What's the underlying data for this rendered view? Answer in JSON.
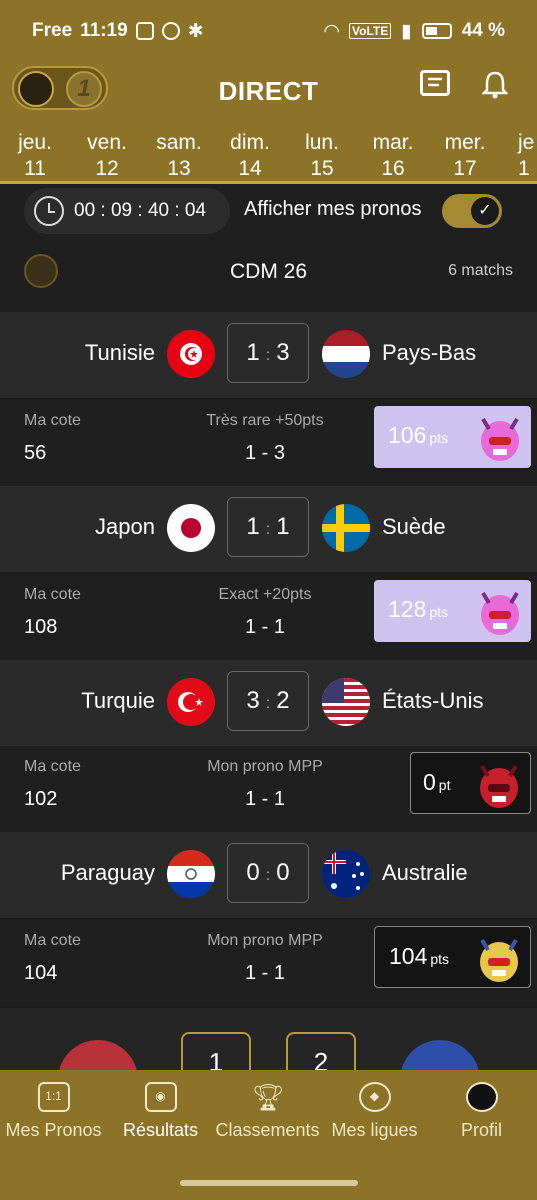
{
  "status_bar": {
    "carrier": "Free",
    "time": "11:19",
    "battery": "44 %"
  },
  "app_bar": {
    "title": "DIRECT",
    "logo_secondary_text": "1",
    "icons": [
      "message-icon",
      "bell-icon"
    ]
  },
  "days": [
    {
      "name": "jeu.",
      "num": "11"
    },
    {
      "name": "ven.",
      "num": "12"
    },
    {
      "name": "sam.",
      "num": "13"
    },
    {
      "name": "dim.",
      "num": "14"
    },
    {
      "name": "lun.",
      "num": "15"
    },
    {
      "name": "mar.",
      "num": "16"
    },
    {
      "name": "mer.",
      "num": "17"
    },
    {
      "name": "je",
      "num": "1"
    }
  ],
  "timer": {
    "value": "00 : 09 : 40 : 04"
  },
  "toggle": {
    "label": "Afficher mes pronos",
    "on": true
  },
  "competition": {
    "name": "CDM 26",
    "count": "6 matchs"
  },
  "matches": [
    {
      "home": "Tunisie",
      "away": "Pays-Bas",
      "home_score": "1",
      "away_score": "3",
      "sep": ":",
      "cote_label": "Ma cote",
      "cote_value": "56",
      "result_label": "Très rare +50pts",
      "prono": "1 - 3",
      "points": "106",
      "points_unit": "pts",
      "style": "light"
    },
    {
      "home": "Japon",
      "away": "Suède",
      "home_score": "1",
      "away_score": "1",
      "sep": ":",
      "cote_label": "Ma cote",
      "cote_value": "108",
      "result_label": "Exact +20pts",
      "prono": "1 - 1",
      "points": "128",
      "points_unit": "pts",
      "style": "light"
    },
    {
      "home": "Turquie",
      "away": "États-Unis",
      "home_score": "3",
      "away_score": "2",
      "sep": ":",
      "cote_label": "Ma cote",
      "cote_value": "102",
      "result_label": "Mon prono MPP",
      "prono": "1 - 1",
      "points": "0",
      "points_unit": "pt",
      "style": "dark"
    },
    {
      "home": "Paraguay",
      "away": "Australie",
      "home_score": "0",
      "away_score": "0",
      "sep": ":",
      "cote_label": "Ma cote",
      "cote_value": "104",
      "result_label": "Mon prono MPP",
      "prono": "1 - 1",
      "points": "104",
      "points_unit": "pts",
      "style": "dark"
    }
  ],
  "peek_match": {
    "home_score": "1",
    "away_score": "2"
  },
  "nav": [
    {
      "label": "Mes Pronos",
      "icon_text": "1:1"
    },
    {
      "label": "Résultats",
      "icon_text": "",
      "active": true
    },
    {
      "label": "Classements",
      "icon_text": ""
    },
    {
      "label": "Mes ligues",
      "icon_text": ""
    },
    {
      "label": "Profil",
      "icon_text": ""
    }
  ],
  "colors": {
    "gold": "#8c7328",
    "gold_light": "#c9a84a",
    "bg": "#1a1a1a",
    "card": "#2a2a2a",
    "lavender": "#cdc3ee"
  }
}
